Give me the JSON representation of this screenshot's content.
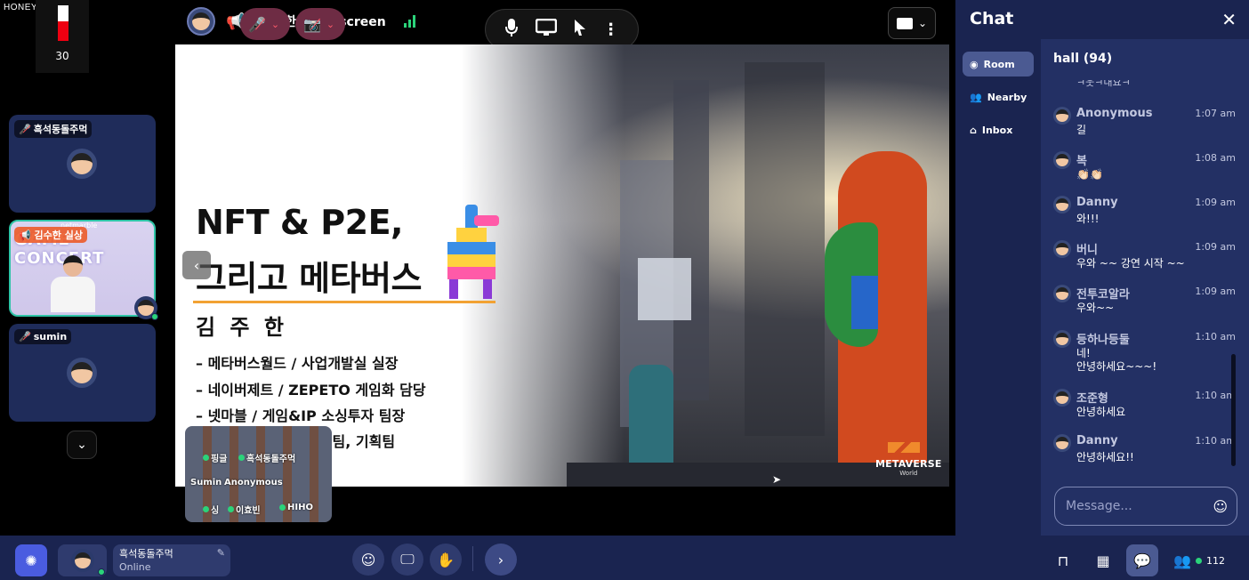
{
  "watermark": "HONEYCAM.ORG",
  "volume_meter": {
    "value": "30",
    "level": 0.55
  },
  "participants": [
    {
      "name": "흑석동돌주먹",
      "muted": true
    },
    {
      "name": "김수한 실상",
      "screen_sharing": true,
      "video_title": "GAME CONCERT",
      "video_brand": "netmarble"
    },
    {
      "name": "sumin",
      "muted": true
    }
  ],
  "share": {
    "title": "김수한 실상's screen"
  },
  "slide": {
    "title_line1": "NFT & P2E,",
    "title_line2": "그리고 메타버스",
    "presenter": "김 주 한",
    "items": [
      "– 메타버스월드 / 사업개발실 실장",
      "– 네이버제트 / ZEPETO 게임화 담당",
      "– 넷마블 / 게임&IP 소싱투자 팀장",
      "– CJ E&M / 대외협력팀, 기획팀"
    ],
    "logo_text": "METAVERSE",
    "logo_sub": "World"
  },
  "minimap": {
    "labels": [
      "핑글",
      "흑석동돌주먹",
      "Sumin",
      "Anonymous",
      "싱",
      "이효빈",
      "HIHO"
    ]
  },
  "chat": {
    "title": "Chat",
    "nav": [
      {
        "label": "Room",
        "active": true
      },
      {
        "label": "Nearby",
        "active": false
      },
      {
        "label": "Inbox",
        "active": false
      }
    ],
    "room_title": "hall (94)",
    "partial_text": "ㅋ웃ㅋ내요ㅋ",
    "messages": [
      {
        "name": "Anonymous",
        "time": "1:07 am",
        "text": "길"
      },
      {
        "name": "복",
        "time": "1:08 am",
        "text": "👏🏻👏🏻"
      },
      {
        "name": "Danny",
        "time": "1:09 am",
        "text": "와!!!"
      },
      {
        "name": "버니",
        "time": "1:09 am",
        "text": "우와 ~~ 강연 시작 ~~"
      },
      {
        "name": "전투코알라",
        "time": "1:09 am",
        "text": "우와~~"
      },
      {
        "name": "등하나등둘",
        "time": "1:10 am",
        "text": "네!",
        "text2": "안녕하세요~~~!"
      },
      {
        "name": "조준형",
        "time": "1:10 am",
        "text": "안녕하세요"
      },
      {
        "name": "Danny",
        "time": "1:10 am",
        "text": "안녕하세요!!"
      }
    ],
    "input_placeholder": "Message..."
  },
  "bottom_bar": {
    "user_name": "흑석동돌주먹",
    "user_status": "Online",
    "participant_count": "112"
  },
  "colors": {
    "panel": "#1a2450",
    "panel_light": "#233064",
    "accent": "#4a5ce0",
    "online": "#2bd37a",
    "danger": "#ff5b6a"
  }
}
